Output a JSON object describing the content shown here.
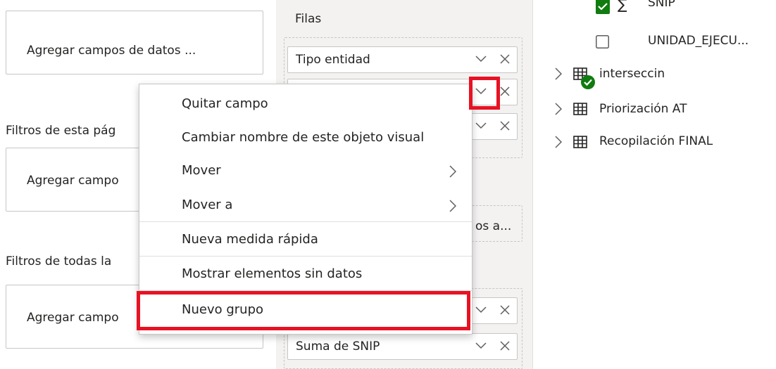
{
  "filters_pane": {
    "visual_filter_placeholder": "Agregar campos de datos ...",
    "page_filters_title": "Filtros de esta pág",
    "page_filter_placeholder": "Agregar campo",
    "all_pages_filters_title": "Filtros de todas la",
    "all_pages_filter_placeholder": "Agregar campo"
  },
  "viz_pane": {
    "rows_label": "Filas",
    "row_fields": [
      "Tipo entidad",
      "",
      ""
    ],
    "columns_placeholder_tail": "os a...",
    "value_fields": [
      "",
      "Suma de SNIP"
    ]
  },
  "fields_pane": {
    "items": [
      {
        "label": "SNIP",
        "checked": true,
        "icon": "sigma-icon"
      },
      {
        "label": "UNIDAD_EJECU...",
        "checked": false
      },
      {
        "label": "interseccin",
        "icon": "table-icon",
        "badge": "check-badge-icon"
      },
      {
        "label": "Priorización AT",
        "icon": "table-icon"
      },
      {
        "label": "Recopilación FINAL",
        "icon": "table-icon"
      }
    ]
  },
  "context_menu": {
    "items": [
      "Quitar campo",
      "Cambiar nombre de este objeto visual",
      "Mover",
      "Mover a",
      "Nueva medida rápida",
      "Mostrar elementos sin datos",
      "Nuevo grupo"
    ]
  },
  "colors": {
    "highlight": "#e81123",
    "checkbox_green": "#107c10",
    "pane_bg": "#f3f2f1"
  }
}
